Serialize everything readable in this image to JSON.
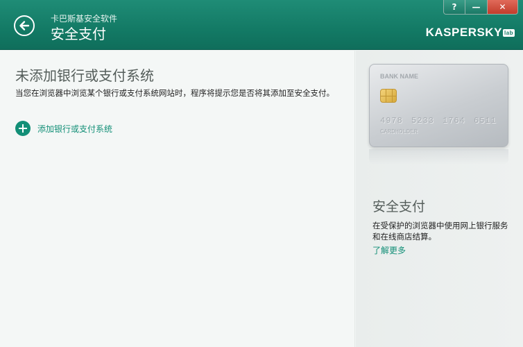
{
  "window": {
    "help_label": "?",
    "minimize_label": "—",
    "close_label": "✕"
  },
  "header": {
    "app_name": "卡巴斯基安全软件",
    "title": "安全支付",
    "brand": "KASPERSKY",
    "brand_suffix": "lab",
    "back_icon": "back-arrow-icon"
  },
  "main": {
    "title": "未添加银行或支付系统",
    "description": "当您在浏览器中浏览某个银行或支付系统网站时，程序将提示您是否将其添加至安全支付。",
    "add_link": "添加银行或支付系统",
    "add_icon": "plus-circle-icon"
  },
  "card": {
    "bank_name": "BANK NAME",
    "number": "4978 5233 1764 6511",
    "holder": "CARDHOLDER"
  },
  "side": {
    "title": "安全支付",
    "description": "在受保护的浏览器中使用网上银行服务和在线商店结算。",
    "learn_more": "了解更多"
  },
  "colors": {
    "header": "#137a65",
    "accent": "#128f77",
    "close": "#c23c2b"
  }
}
